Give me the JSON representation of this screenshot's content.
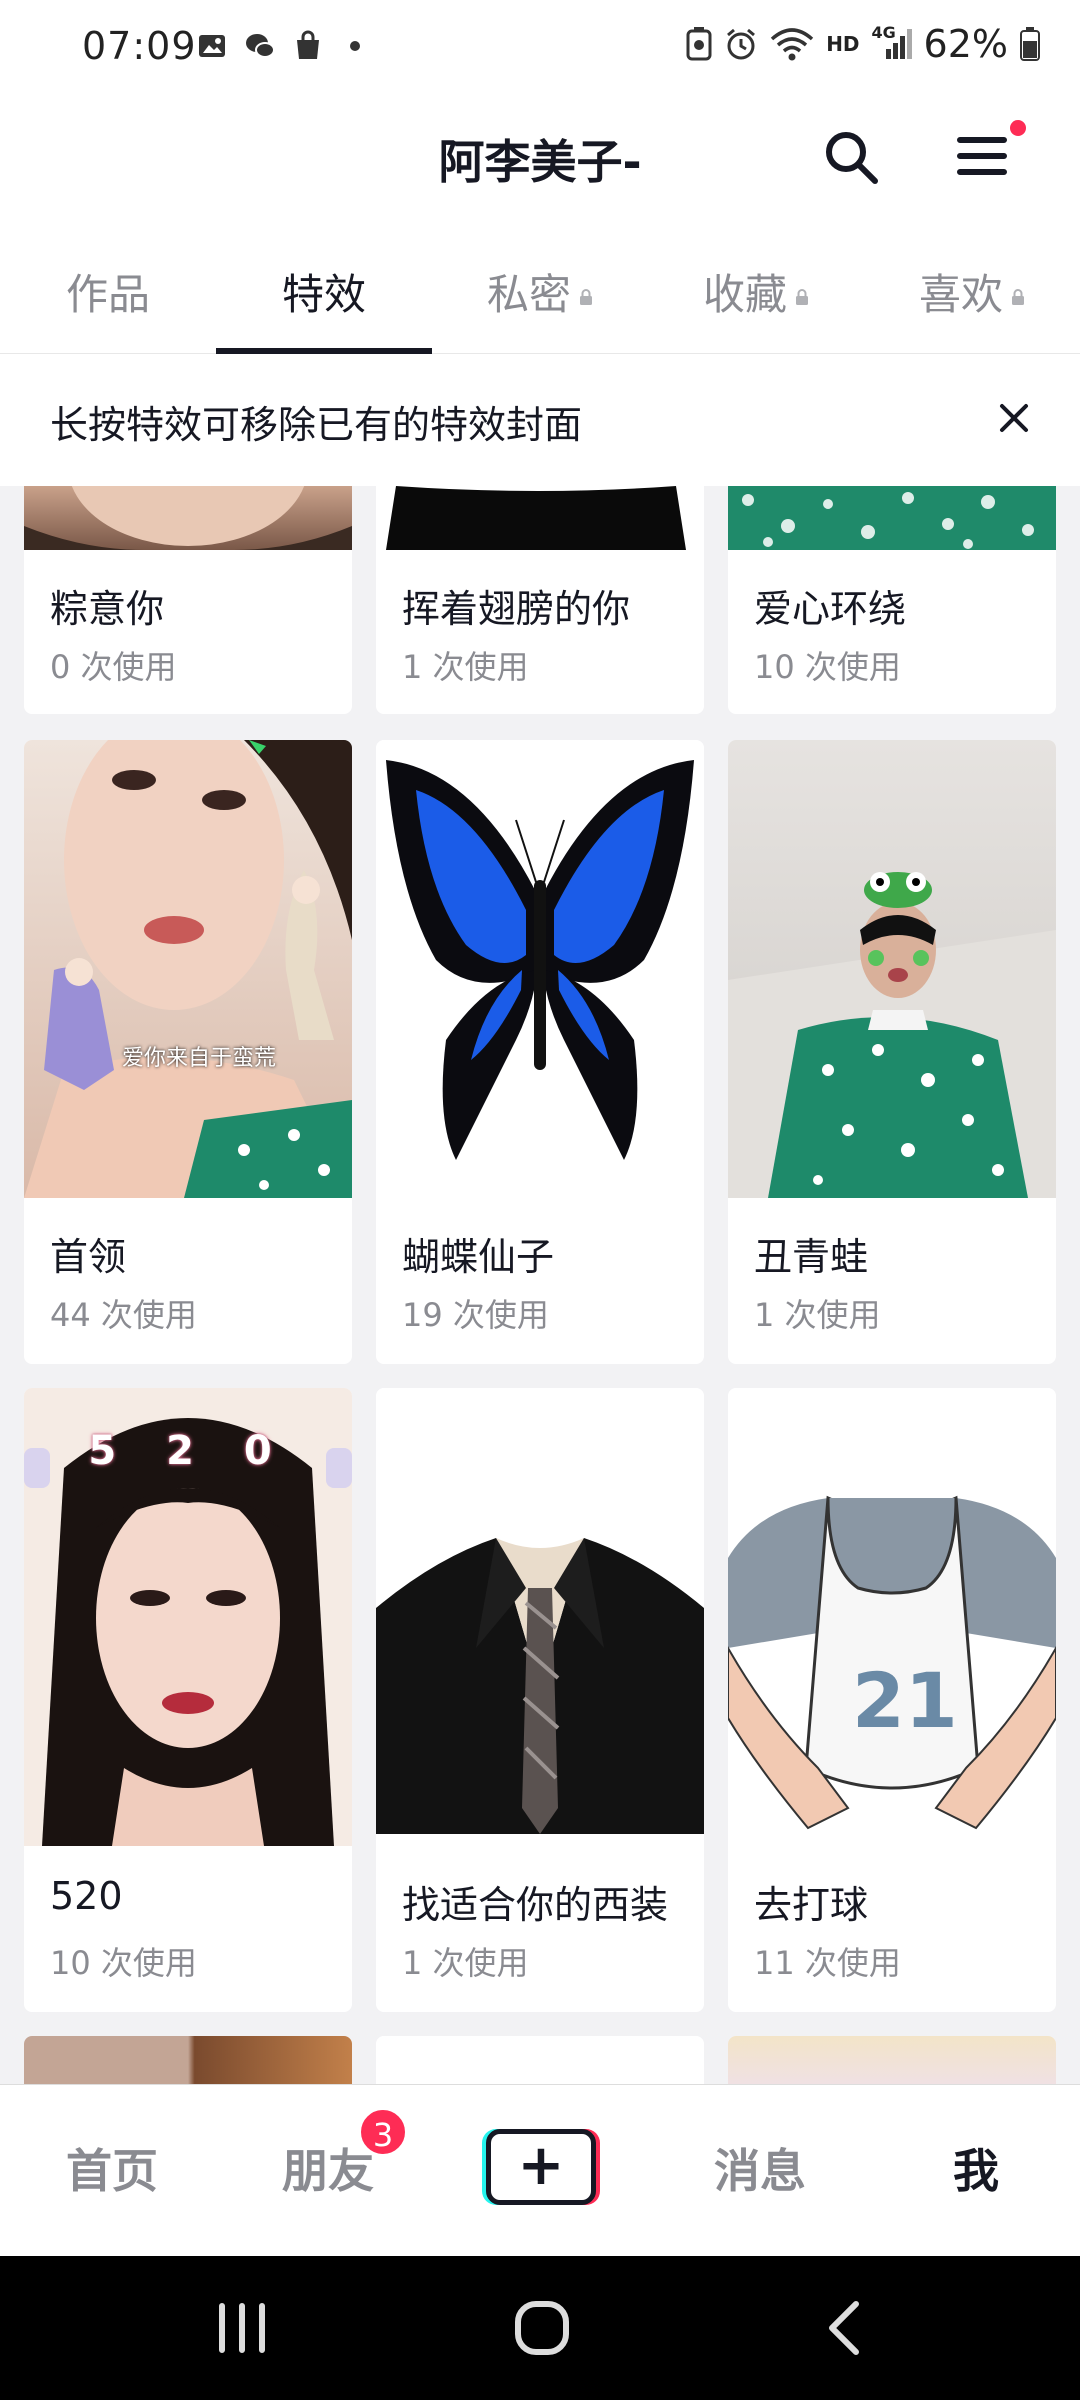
{
  "status_bar": {
    "time": "07:09",
    "battery": "62%",
    "network": "4G",
    "hd": "HD"
  },
  "header": {
    "title": "阿李美子-"
  },
  "tabs": [
    {
      "label": "作品",
      "locked": false,
      "active": false
    },
    {
      "label": "特效",
      "locked": false,
      "active": true
    },
    {
      "label": "私密",
      "locked": true,
      "active": false
    },
    {
      "label": "收藏",
      "locked": true,
      "active": false
    },
    {
      "label": "喜欢",
      "locked": true,
      "active": false
    }
  ],
  "notice": {
    "text": "长按特效可移除已有的特效封面"
  },
  "effects": [
    {
      "name": "粽意你",
      "uses": "0 次使用"
    },
    {
      "name": "挥着翅膀的你",
      "uses": "1 次使用"
    },
    {
      "name": "爱心环绕",
      "uses": "10 次使用"
    },
    {
      "name": "首领",
      "uses": "44 次使用",
      "overlay": "爱你来自于蛮荒"
    },
    {
      "name": "蝴蝶仙子",
      "uses": "19 次使用"
    },
    {
      "name": "丑青蛙",
      "uses": "1 次使用"
    },
    {
      "name": "520",
      "uses": "10 次使用",
      "overlay": "5 2 0"
    },
    {
      "name": "找适合你的西装",
      "uses": "1 次使用"
    },
    {
      "name": "去打球",
      "uses": "11 次使用",
      "overlay": "21"
    }
  ],
  "bottom_nav": {
    "home": "首页",
    "friends": "朋友",
    "friends_badge": "3",
    "create": "+",
    "messages": "消息",
    "me": "我"
  },
  "colors": {
    "accent": "#fe2c55",
    "cyan": "#25f4ee",
    "text": "#161823",
    "secondary": "#8a8b91",
    "grid_bg": "#f2f2f4"
  }
}
